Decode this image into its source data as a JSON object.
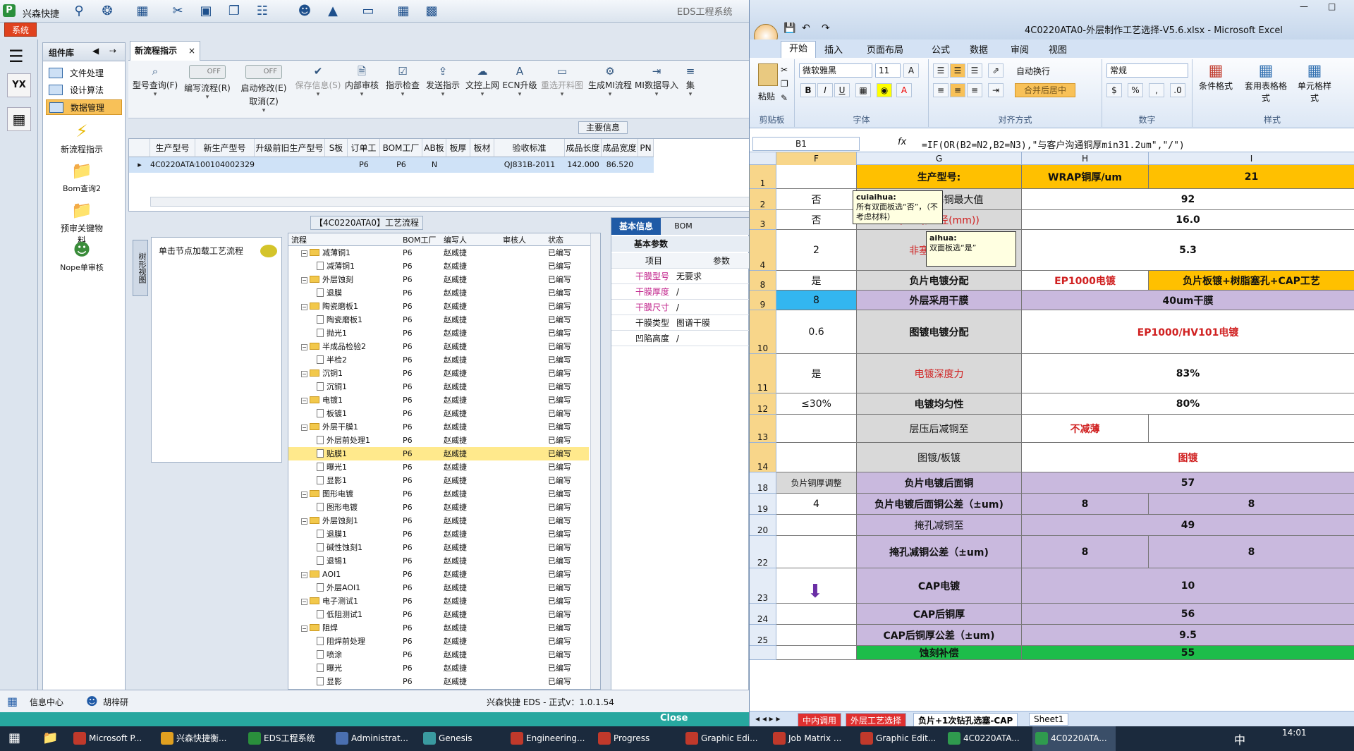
{
  "eds": {
    "app_name": "兴森快捷",
    "window_title": "EDS工程系统",
    "system_button": "系统",
    "sidebar_title": "组件库",
    "sidebar_items": [
      "文件处理",
      "设计算法",
      "数据管理"
    ],
    "tools": [
      "新流程指示",
      "Bom查询2",
      "预审关键物料",
      "Nope单审核"
    ],
    "tab": "新流程指示",
    "toolbar": [
      {
        "label": "型号查询(F)",
        "icon": "⌕"
      },
      {
        "label": "编写流程(R)",
        "toggle": "OFF"
      },
      {
        "label": "启动修改(E)",
        "label2": "取消(Z)",
        "toggle": "OFF"
      },
      {
        "label": "保存信息(S)",
        "icon": "✔",
        "disabled": true
      },
      {
        "label": "内部审核",
        "icon": "🗎"
      },
      {
        "label": "指示检查",
        "icon": "☑"
      },
      {
        "label": "发送指示",
        "icon": "⇪"
      },
      {
        "label": "文控上网",
        "icon": "☁"
      },
      {
        "label": "ECN升级",
        "icon": "A"
      },
      {
        "label": "重选开料图",
        "icon": "▭",
        "disabled": true
      },
      {
        "label": "生成MI流程",
        "icon": "⚙"
      },
      {
        "label": "MI数据导入",
        "icon": "⇥"
      },
      {
        "label": "集",
        "icon": "≡"
      }
    ],
    "main_info_label": "主要信息",
    "grid_headers": [
      "生产型号",
      "新生产型号",
      "升级前旧生产型号",
      "S板",
      "订单工厂",
      "BOM工厂",
      "AB板",
      "板厚",
      "板材",
      "验收标准",
      "成品长度",
      "成品宽度",
      "PN"
    ],
    "grid_row": [
      "4C0220ATA0",
      "10010400232991",
      "",
      "",
      "P6",
      "P6",
      "N",
      "",
      "",
      "QJ831B-2011",
      "142.000",
      "86.520",
      ""
    ],
    "tree_title": "【4C0220ATA0】工艺流程",
    "left_hint": "单击节点加载工艺流程",
    "left_tab": "树形视图",
    "tree_headers": [
      "流程",
      "BOM工厂",
      "编写人",
      "审核人",
      "状态"
    ],
    "tree_rows": [
      {
        "n": "减薄铜1",
        "l": 1,
        "t": "f",
        "x": true
      },
      {
        "n": "减薄铜1",
        "l": 2,
        "t": "d"
      },
      {
        "n": "外层蚀刻",
        "l": 1,
        "t": "f",
        "x": true
      },
      {
        "n": "退膜",
        "l": 2,
        "t": "d"
      },
      {
        "n": "陶瓷磨板1",
        "l": 1,
        "t": "f",
        "x": true
      },
      {
        "n": "陶瓷磨板1",
        "l": 2,
        "t": "d"
      },
      {
        "n": "抛光1",
        "l": 2,
        "t": "d"
      },
      {
        "n": "半成品检验2",
        "l": 1,
        "t": "f",
        "x": true
      },
      {
        "n": "半检2",
        "l": 2,
        "t": "d"
      },
      {
        "n": "沉铜1",
        "l": 1,
        "t": "f",
        "x": true
      },
      {
        "n": "沉铜1",
        "l": 2,
        "t": "d"
      },
      {
        "n": "电镀1",
        "l": 1,
        "t": "f",
        "x": true
      },
      {
        "n": "板镀1",
        "l": 2,
        "t": "d"
      },
      {
        "n": "外层干膜1",
        "l": 1,
        "t": "f",
        "x": true
      },
      {
        "n": "外层前处理1",
        "l": 2,
        "t": "d"
      },
      {
        "n": "贴膜1",
        "l": 2,
        "t": "d",
        "sel": true
      },
      {
        "n": "曝光1",
        "l": 2,
        "t": "d"
      },
      {
        "n": "显影1",
        "l": 2,
        "t": "d"
      },
      {
        "n": "图形电镀",
        "l": 1,
        "t": "f",
        "x": true
      },
      {
        "n": "图形电镀",
        "l": 2,
        "t": "d"
      },
      {
        "n": "外层蚀刻1",
        "l": 1,
        "t": "f",
        "x": true
      },
      {
        "n": "退膜1",
        "l": 2,
        "t": "d"
      },
      {
        "n": "碱性蚀刻1",
        "l": 2,
        "t": "d"
      },
      {
        "n": "退锡1",
        "l": 2,
        "t": "d"
      },
      {
        "n": "AOI1",
        "l": 1,
        "t": "f",
        "x": true
      },
      {
        "n": "外层AOI1",
        "l": 2,
        "t": "d"
      },
      {
        "n": "电子测试1",
        "l": 1,
        "t": "f",
        "x": true
      },
      {
        "n": "低阻测试1",
        "l": 2,
        "t": "d"
      },
      {
        "n": "阻焊",
        "l": 1,
        "t": "f",
        "x": true
      },
      {
        "n": "阻焊前处理",
        "l": 2,
        "t": "d"
      },
      {
        "n": "喷涂",
        "l": 2,
        "t": "d"
      },
      {
        "n": "曝光",
        "l": 2,
        "t": "d"
      },
      {
        "n": "显影",
        "l": 2,
        "t": "d"
      }
    ],
    "tree_bom": "P6",
    "tree_writer": "赵威捷",
    "tree_status": "已编写",
    "basic_tabs": [
      "基本信息",
      "BOM"
    ],
    "basic_head": "基本参数",
    "basic_cols": [
      "项目",
      "参数"
    ],
    "basic_rows": [
      [
        "干膜型号",
        "无要求"
      ],
      [
        "干膜厚度",
        "/"
      ],
      [
        "干膜尺寸",
        "/"
      ],
      [
        "干膜类型",
        "图谱干膜"
      ],
      [
        "凹陷高度",
        "/"
      ]
    ],
    "status_user": "胡梓研",
    "status_info": "信息中心",
    "status_version": "兴森快捷 EDS - 正式v：1.0.1.54",
    "close": "Close"
  },
  "excel": {
    "title": "4C0220ATA0-外层制作工艺选择-V5.6.xlsx - Microsoft Excel",
    "tabs": [
      "开始",
      "插入",
      "页面布局",
      "公式",
      "数据",
      "审阅",
      "视图"
    ],
    "font": "微软雅黑",
    "font_size": "11",
    "number_format": "常规",
    "groups": [
      "剪贴板",
      "字体",
      "对齐方式",
      "数字",
      "样式"
    ],
    "paste": "粘贴",
    "wrap": "自动换行",
    "merge": "合并后居中",
    "cond": "条件格式",
    "table_fmt": "套用表格格式",
    "cell_style": "单元格样式",
    "name_box": "B1",
    "formula": "=IF(OR(B2=N2,B2=N3),\"与客户沟通铜厚min31.2um\",\"/\")",
    "cols": [
      "F",
      "G",
      "H",
      "I"
    ],
    "rows": [
      {
        "r": "1",
        "h": 34,
        "f": "",
        "g": "生产型号:",
        "hh": "WRAP铜厚/um",
        "i": "21"
      },
      {
        "r": "2",
        "h": 30,
        "f": "否",
        "g": "碱蚀蚀刻基铜最大值",
        "hh": "92",
        "merge": true
      },
      {
        "r": "3",
        "h": 28,
        "f": "否",
        "g": "(mm)/孔径(mm))",
        "hh": "16.0",
        "merge": true
      },
      {
        "r": "4",
        "h": 58,
        "f": "2",
        "g": "非塞孔K(板厚",
        "hh": "5.3",
        "merge": true
      },
      {
        "r": "8",
        "h": 28,
        "f": "是",
        "g": "负片电镀分配",
        "hh": "EP1000电镀",
        "i": "负片板镀+树脂塞孔+CAP工艺"
      },
      {
        "r": "9",
        "h": 28,
        "f": "8",
        "g": "外层采用干膜",
        "hh": "40um干膜",
        "merge": true
      },
      {
        "r": "10",
        "h": 62,
        "f": "0.6",
        "g": "图镀电镀分配",
        "hh": "EP1000/HV101电镀",
        "merge": true
      },
      {
        "r": "11",
        "h": 56,
        "f": "是",
        "g": "电镀深度力",
        "hh": "83%",
        "merge": true
      },
      {
        "r": "12",
        "h": 30,
        "f": "≤30%",
        "g": "电镀均匀性",
        "hh": "80%",
        "merge": true
      },
      {
        "r": "13",
        "h": 40,
        "f": "",
        "g": "层压后减铜至",
        "hh": "不减薄",
        "i": ""
      },
      {
        "r": "14",
        "h": 42,
        "f": "",
        "g": "图镀/板镀",
        "hh": "图镀",
        "merge": true
      },
      {
        "r": "18",
        "h": 30,
        "f": "负片铜厚调整",
        "g": "负片电镀后面铜",
        "hh": "57",
        "merge": true
      },
      {
        "r": "19",
        "h": 30,
        "f": "4",
        "g": "负片电镀后面铜公差（±um)",
        "hh": "8",
        "i": "8"
      },
      {
        "r": "20",
        "h": 30,
        "f": "",
        "g": "掩孔减铜至",
        "hh": "49",
        "merge": true
      },
      {
        "r": "22",
        "h": 46,
        "f": "",
        "g": "掩孔减铜公差（±um)",
        "hh": "8",
        "i": "8"
      },
      {
        "r": "23",
        "h": 50,
        "f": "",
        "g": "CAP电镀",
        "hh": "10",
        "merge": true
      },
      {
        "r": "24",
        "h": 30,
        "f": "",
        "g": "CAP后铜厚",
        "hh": "56",
        "merge": true
      },
      {
        "r": "25",
        "h": 30,
        "f": "",
        "g": "CAP后铜厚公差（±um)",
        "hh": "9.5",
        "merge": true
      },
      {
        "r": "",
        "h": 20,
        "f": "",
        "g": "蚀刻补偿",
        "hh": "55",
        "merge": true
      }
    ],
    "notes": [
      {
        "author": "cuiaihua:",
        "text": "所有双面板选“否”，（不考虑材料）"
      },
      {
        "author": "aihua:",
        "text": "双面板选“是”"
      }
    ],
    "sheet_tabs": [
      "中内调用",
      "外层工艺选择",
      "负片+1次钻孔选塞-CAP",
      "Sheet1"
    ]
  },
  "taskbar": {
    "items": [
      "Microsoft P...",
      "兴森快捷衡...",
      "EDS工程系统",
      "Administrat...",
      "Genesis",
      "Engineering...",
      "Progress",
      "Graphic Edi...",
      "Job Matrix ...",
      "Graphic Edit...",
      "4C0220ATA...",
      "4C0220ATA..."
    ],
    "ime": "中",
    "time": "14:01"
  }
}
